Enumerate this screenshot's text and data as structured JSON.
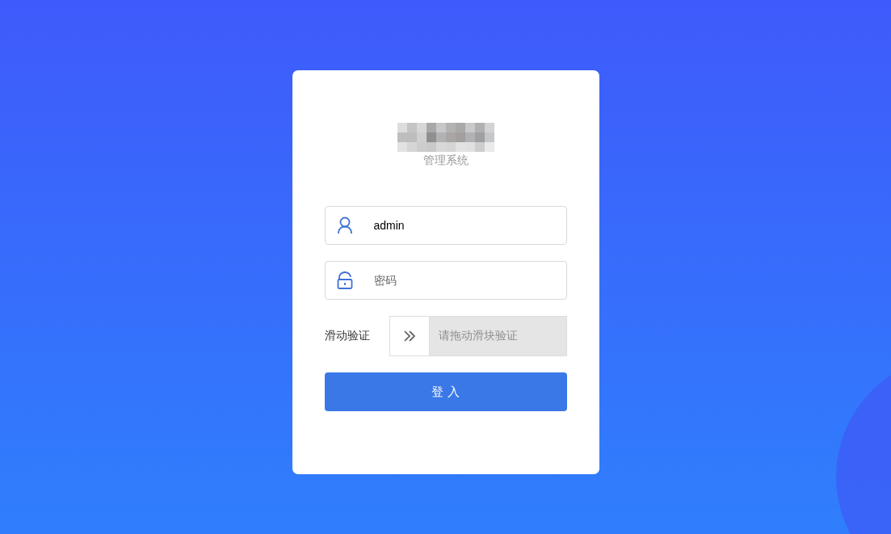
{
  "login": {
    "subtitle": "管理系统",
    "username": {
      "value": "admin"
    },
    "password": {
      "placeholder": "密码"
    },
    "slider": {
      "label": "滑动验证",
      "hint": "请拖动滑块验证",
      "level": 0
    },
    "submit": "登 入"
  }
}
